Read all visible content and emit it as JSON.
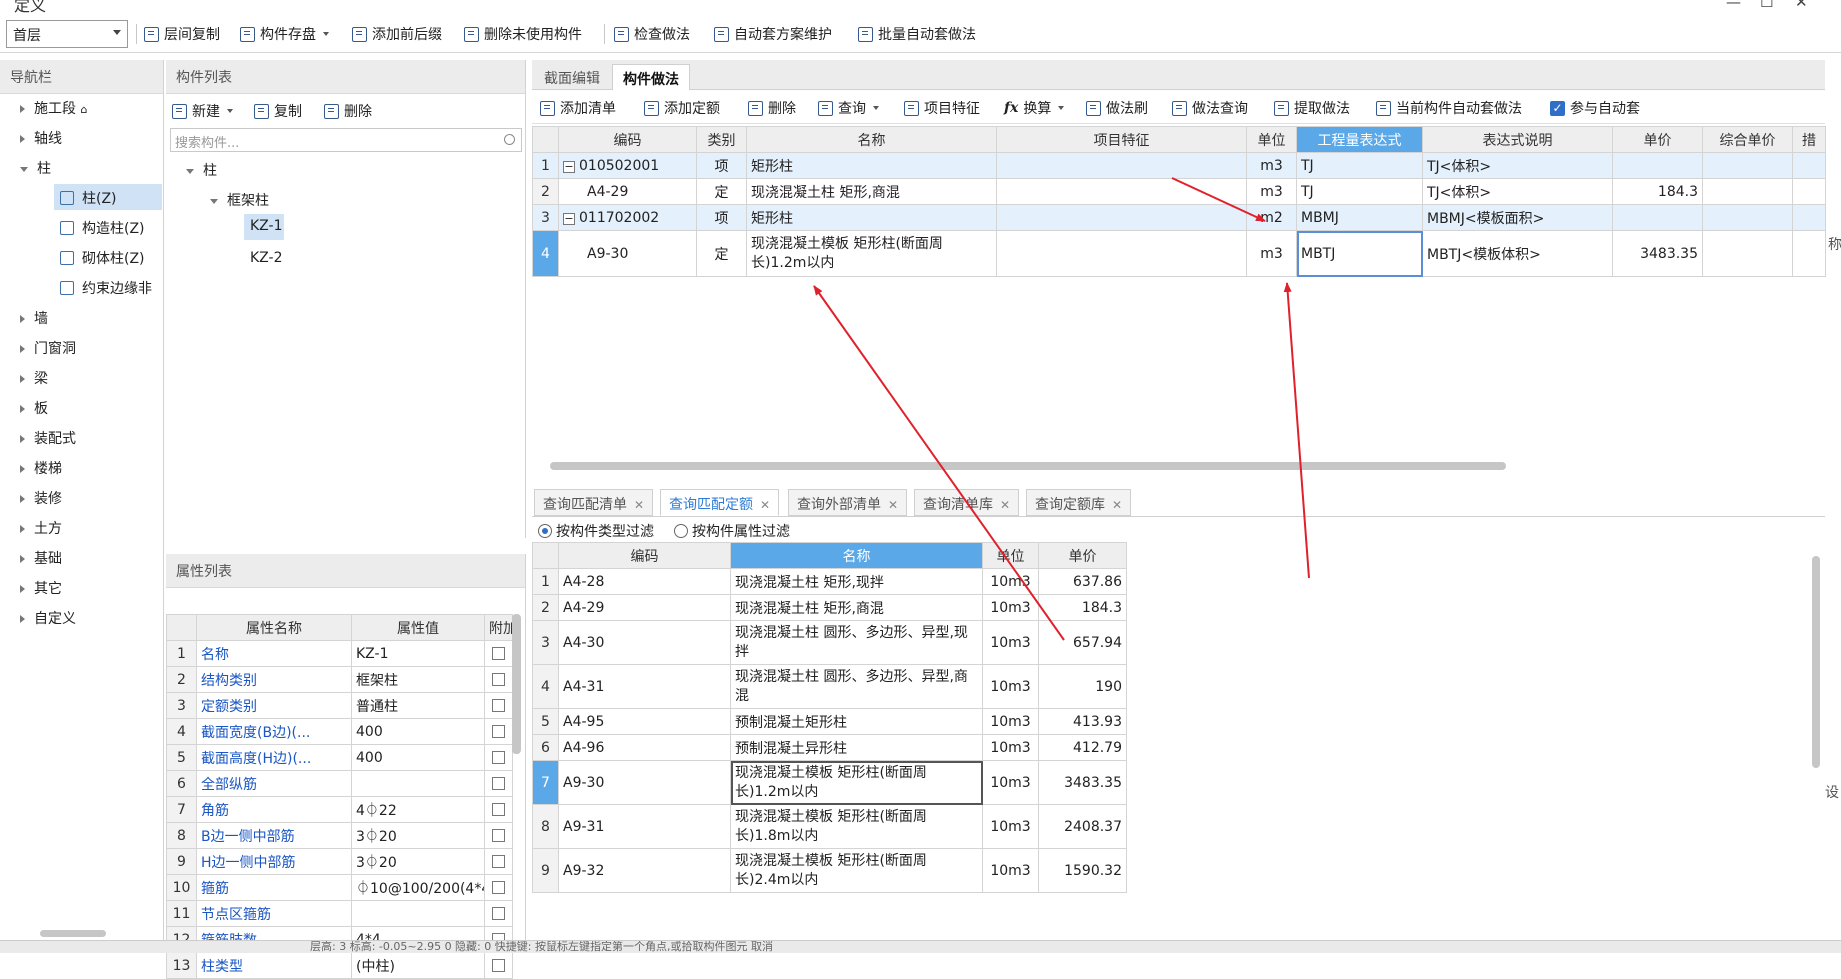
{
  "window": {
    "title": "定义"
  },
  "toolbar": {
    "floor": "首层",
    "buttons": [
      "层间复制",
      "构件存盘",
      "添加前后缀",
      "删除未使用构件",
      "检查做法",
      "自动套方案维护",
      "批量自动套做法"
    ]
  },
  "nav": {
    "title": "导航栏",
    "items": [
      "施工段",
      "轴线",
      "柱",
      "墙",
      "门窗洞",
      "梁",
      "板",
      "装配式",
      "楼梯",
      "装修",
      "土方",
      "基础",
      "其它",
      "自定义"
    ],
    "column_sub": [
      "柱(Z)",
      "构造柱(Z)",
      "砌体柱(Z)",
      "约束边缘非"
    ]
  },
  "component_list": {
    "title": "构件列表",
    "buttons": [
      "新建",
      "复制",
      "删除"
    ],
    "search_placeholder": "搜索构件...",
    "tree_root": "柱",
    "tree_group": "框架柱",
    "items": [
      "KZ-1",
      "KZ-2"
    ]
  },
  "properties": {
    "title": "属性列表",
    "headers": [
      "属性名称",
      "属性值",
      "附加"
    ],
    "rows": [
      {
        "n": "1",
        "name": "名称",
        "value": "KZ-1"
      },
      {
        "n": "2",
        "name": "结构类别",
        "value": "框架柱"
      },
      {
        "n": "3",
        "name": "定额类别",
        "value": "普通柱"
      },
      {
        "n": "4",
        "name": "截面宽度(B边)(...",
        "value": "400"
      },
      {
        "n": "5",
        "name": "截面高度(H边)(...",
        "value": "400"
      },
      {
        "n": "6",
        "name": "全部纵筋",
        "value": ""
      },
      {
        "n": "7",
        "name": "角筋",
        "value": "4⏀22"
      },
      {
        "n": "8",
        "name": "B边一侧中部筋",
        "value": "3⏀20"
      },
      {
        "n": "9",
        "name": "H边一侧中部筋",
        "value": "3⏀20"
      },
      {
        "n": "10",
        "name": "箍筋",
        "value": "⏀10@100/200(4*4)"
      },
      {
        "n": "11",
        "name": "节点区箍筋",
        "value": ""
      },
      {
        "n": "12",
        "name": "箍筋肢数",
        "value": "4*4"
      },
      {
        "n": "13",
        "name": "柱类型",
        "value": "(中柱)"
      }
    ]
  },
  "method": {
    "tabs": [
      "截面编辑",
      "构件做法"
    ],
    "buttons": [
      "添加清单",
      "添加定额",
      "删除",
      "查询",
      "项目特征",
      "换算",
      "做法刷",
      "做法查询",
      "提取做法",
      "当前构件自动套做法",
      "参与自动套"
    ],
    "headers": [
      "编码",
      "类别",
      "名称",
      "项目特征",
      "单位",
      "工程量表达式",
      "表达式说明",
      "单价",
      "综合单价",
      "措"
    ],
    "rows": [
      {
        "n": "1",
        "code": "010502001",
        "type": "项",
        "name": "矩形柱",
        "unit": "m3",
        "expr": "TJ",
        "desc": "TJ<体积>",
        "price": ""
      },
      {
        "n": "2",
        "code": "A4-29",
        "type": "定",
        "name": "现浇混凝土柱 矩形,商混",
        "unit": "m3",
        "expr": "TJ",
        "desc": "TJ<体积>",
        "price": "184.3"
      },
      {
        "n": "3",
        "code": "011702002",
        "type": "项",
        "name": "矩形柱",
        "unit": "m2",
        "expr": "MBMJ",
        "desc": "MBMJ<模板面积>",
        "price": ""
      },
      {
        "n": "4",
        "code": "A9-30",
        "type": "定",
        "name": "现浇混凝土模板 矩形柱(断面周长)1.2m以内",
        "unit": "m3",
        "expr": "MBTJ",
        "desc": "MBTJ<模板体积>",
        "price": "3483.35"
      }
    ],
    "side_text": "称"
  },
  "query": {
    "tabs": [
      "查询匹配清单",
      "查询匹配定额",
      "查询外部清单",
      "查询清单库",
      "查询定额库"
    ],
    "filters": [
      "按构件类型过滤",
      "按构件属性过滤"
    ],
    "headers": [
      "编码",
      "名称",
      "单位",
      "单价"
    ],
    "rows": [
      {
        "n": "1",
        "code": "A4-28",
        "name": "现浇混凝土柱 矩形,现拌",
        "unit": "10m3",
        "price": "637.86"
      },
      {
        "n": "2",
        "code": "A4-29",
        "name": "现浇混凝土柱 矩形,商混",
        "unit": "10m3",
        "price": "184.3"
      },
      {
        "n": "3",
        "code": "A4-30",
        "name": "现浇混凝土柱 圆形、多边形、异型,现拌",
        "unit": "10m3",
        "price": "657.94"
      },
      {
        "n": "4",
        "code": "A4-31",
        "name": "现浇混凝土柱 圆形、多边形、异型,商混",
        "unit": "10m3",
        "price": "190"
      },
      {
        "n": "5",
        "code": "A4-95",
        "name": "预制混凝土矩形柱",
        "unit": "10m3",
        "price": "413.93"
      },
      {
        "n": "6",
        "code": "A4-96",
        "name": "预制混凝土异形柱",
        "unit": "10m3",
        "price": "412.79"
      },
      {
        "n": "7",
        "code": "A9-30",
        "name": "现浇混凝土模板 矩形柱(断面周长)1.2m以内",
        "unit": "10m3",
        "price": "3483.35"
      },
      {
        "n": "8",
        "code": "A9-31",
        "name": "现浇混凝土模板 矩形柱(断面周长)1.8m以内",
        "unit": "10m3",
        "price": "2408.37"
      },
      {
        "n": "9",
        "code": "A9-32",
        "name": "现浇混凝土模板 矩形柱(断面周长)2.4m以内",
        "unit": "10m3",
        "price": "1590.32"
      }
    ],
    "side_text": "设"
  },
  "status": {
    "text": "层高: 3   标高: -0.05~2.95  0   隐藏: 0   快捷键: 按鼠标左键指定第一个角点,或拾取构件图元  取消"
  },
  "colors": {
    "accent": "#5aa8e8",
    "annotation": "#e0202a",
    "link": "#1a56c4"
  }
}
